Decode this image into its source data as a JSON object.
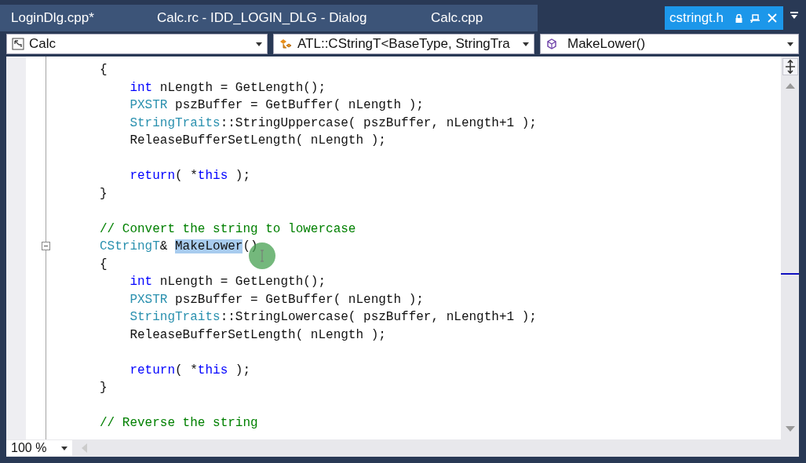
{
  "tabs": [
    {
      "label": "LoginDlg.cpp*",
      "selected": false
    },
    {
      "label": "Calc.rc - IDD_LOGIN_DLG - Dialog",
      "selected": false
    },
    {
      "label": "Calc.cpp",
      "selected": false
    },
    {
      "label": "cstringt.h",
      "selected": true
    }
  ],
  "navigation": {
    "scope": "Calc",
    "type": "ATL::CStringT<BaseType, StringTra",
    "member": "MakeLower()"
  },
  "code_lines": [
    {
      "kind": "code",
      "fold_marker": false,
      "tokens": [
        {
          "kind": "plain",
          "text": "{"
        }
      ]
    },
    {
      "kind": "code",
      "fold_marker": false,
      "tokens": [
        {
          "kind": "keyword",
          "text": "    int"
        },
        {
          "kind": "plain",
          "text": " nLength = GetLength();"
        }
      ]
    },
    {
      "kind": "code",
      "fold_marker": false,
      "tokens": [
        {
          "kind": "type",
          "text": "    PXSTR"
        },
        {
          "kind": "plain",
          "text": " pszBuffer = GetBuffer( nLength );"
        }
      ]
    },
    {
      "kind": "code",
      "fold_marker": false,
      "tokens": [
        {
          "kind": "type",
          "text": "    StringTraits"
        },
        {
          "kind": "plain",
          "text": "::StringUppercase( pszBuffer, nLength+1 );"
        }
      ]
    },
    {
      "kind": "code",
      "fold_marker": false,
      "tokens": [
        {
          "kind": "plain",
          "text": "    ReleaseBufferSetLength( nLength );"
        }
      ]
    },
    {
      "kind": "blank"
    },
    {
      "kind": "code",
      "fold_marker": false,
      "tokens": [
        {
          "kind": "keyword",
          "text": "    return"
        },
        {
          "kind": "plain",
          "text": "( *"
        },
        {
          "kind": "keyword",
          "text": "this"
        },
        {
          "kind": "plain",
          "text": " );"
        }
      ]
    },
    {
      "kind": "code",
      "fold_marker": false,
      "tokens": [
        {
          "kind": "plain",
          "text": "}"
        }
      ]
    },
    {
      "kind": "blank"
    },
    {
      "kind": "code",
      "fold_marker": false,
      "tokens": [
        {
          "kind": "comment",
          "text": "// Convert the string to lowercase"
        }
      ]
    },
    {
      "kind": "code",
      "fold_marker": true,
      "tokens": [
        {
          "kind": "type",
          "text": "CStringT"
        },
        {
          "kind": "plain",
          "text": "& "
        },
        {
          "kind": "selected",
          "text": "MakeLower"
        },
        {
          "kind": "plain",
          "text": "()"
        }
      ]
    },
    {
      "kind": "code",
      "fold_marker": false,
      "tokens": [
        {
          "kind": "plain",
          "text": "{"
        }
      ]
    },
    {
      "kind": "code",
      "fold_marker": false,
      "tokens": [
        {
          "kind": "keyword",
          "text": "    int"
        },
        {
          "kind": "plain",
          "text": " nLength = GetLength();"
        }
      ]
    },
    {
      "kind": "code",
      "fold_marker": false,
      "tokens": [
        {
          "kind": "type",
          "text": "    PXSTR"
        },
        {
          "kind": "plain",
          "text": " pszBuffer = GetBuffer( nLength );"
        }
      ]
    },
    {
      "kind": "code",
      "fold_marker": false,
      "tokens": [
        {
          "kind": "type",
          "text": "    StringTraits"
        },
        {
          "kind": "plain",
          "text": "::StringLowercase( pszBuffer, nLength+1 );"
        }
      ]
    },
    {
      "kind": "code",
      "fold_marker": false,
      "tokens": [
        {
          "kind": "plain",
          "text": "    ReleaseBufferSetLength( nLength );"
        }
      ]
    },
    {
      "kind": "blank"
    },
    {
      "kind": "code",
      "fold_marker": false,
      "tokens": [
        {
          "kind": "keyword",
          "text": "    return"
        },
        {
          "kind": "plain",
          "text": "( *"
        },
        {
          "kind": "keyword",
          "text": "this"
        },
        {
          "kind": "plain",
          "text": " );"
        }
      ]
    },
    {
      "kind": "code",
      "fold_marker": false,
      "tokens": [
        {
          "kind": "plain",
          "text": "}"
        }
      ]
    },
    {
      "kind": "blank"
    },
    {
      "kind": "code",
      "fold_marker": false,
      "tokens": [
        {
          "kind": "comment",
          "text": "// Reverse the string"
        }
      ]
    }
  ],
  "zoom": "100 %"
}
